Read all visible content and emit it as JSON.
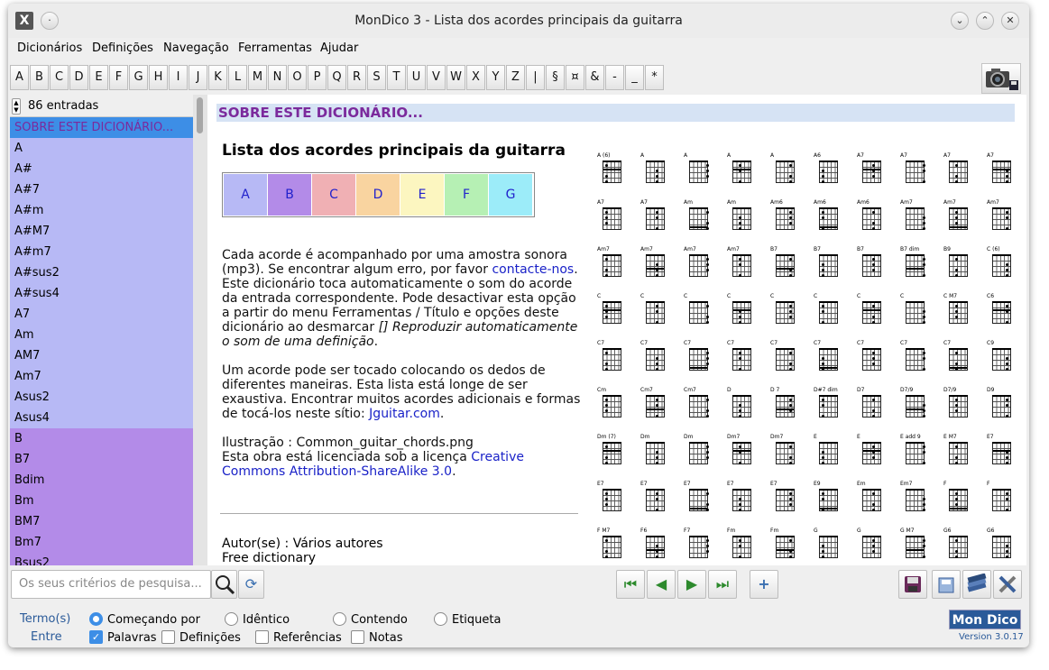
{
  "window": {
    "title": "MonDico 3 - Lista dos acordes principais da guitarra"
  },
  "menubar": [
    "Dicionários",
    "Definições",
    "Navegação",
    "Ferramentas",
    "Ajudar"
  ],
  "alphabet": [
    "A",
    "B",
    "C",
    "D",
    "E",
    "F",
    "G",
    "H",
    "I",
    "J",
    "K",
    "L",
    "M",
    "N",
    "O",
    "P",
    "Q",
    "R",
    "S",
    "T",
    "U",
    "V",
    "W",
    "X",
    "Y",
    "Z",
    "|",
    "§",
    "¤",
    "&",
    "-",
    "_",
    "*"
  ],
  "sidebar": {
    "count_label": "86 entradas",
    "entries": [
      {
        "label": "SOBRE ESTE DICIONÁRIO...",
        "group": "sel"
      },
      {
        "label": "A",
        "group": "a"
      },
      {
        "label": "A#",
        "group": "a"
      },
      {
        "label": "A#7",
        "group": "a"
      },
      {
        "label": "A#m",
        "group": "a"
      },
      {
        "label": "A#M7",
        "group": "a"
      },
      {
        "label": "A#m7",
        "group": "a"
      },
      {
        "label": "A#sus2",
        "group": "a"
      },
      {
        "label": "A#sus4",
        "group": "a"
      },
      {
        "label": "A7",
        "group": "a"
      },
      {
        "label": "Am",
        "group": "a"
      },
      {
        "label": "AM7",
        "group": "a"
      },
      {
        "label": "Am7",
        "group": "a"
      },
      {
        "label": "Asus2",
        "group": "a"
      },
      {
        "label": "Asus4",
        "group": "a"
      },
      {
        "label": "B",
        "group": "b"
      },
      {
        "label": "B7",
        "group": "b"
      },
      {
        "label": "Bdim",
        "group": "b"
      },
      {
        "label": "Bm",
        "group": "b"
      },
      {
        "label": "BM7",
        "group": "b"
      },
      {
        "label": "Bm7",
        "group": "b"
      },
      {
        "label": "Bsus2",
        "group": "b"
      }
    ]
  },
  "content": {
    "banner": "SOBRE ESTE DICIONÁRIO...",
    "heading": "Lista dos acordes principais da guitarra",
    "letters": [
      {
        "label": "A",
        "color": "#b7b9f5"
      },
      {
        "label": "B",
        "color": "#b38be8"
      },
      {
        "label": "C",
        "color": "#f0b0b4"
      },
      {
        "label": "D",
        "color": "#f9d4a0"
      },
      {
        "label": "E",
        "color": "#fcf6c0"
      },
      {
        "label": "F",
        "color": "#b6f0b4"
      },
      {
        "label": "G",
        "color": "#9cecf9"
      }
    ],
    "p1_text": "Cada acorde é acompanhado por uma amostra sonora (mp3). Se encontrar algum erro, por favor ",
    "p1_link": "contacte-nos",
    "p1_end": ".",
    "p2_text": "Este dicionário toca automaticamente o som do acorde da entrada correspondente. Pode desactivar esta opção a partir do menu Ferramentas / Título e opções deste dicionário ao desmarcar ",
    "p2_italic": "[] Reproduzir automaticamente o som de uma definição",
    "p2_end": ".",
    "p3_text": "Um acorde pode ser tocado colocando os dedos de diferentes maneiras. Esta lista está longe de ser exaustiva. Encontrar muitos acordes adicionais e formas de tocá-los neste sítio: ",
    "p3_link": "Jguitar.com",
    "p3_end": ".",
    "p4_line1": "Ilustração : Common_guitar_chords.png",
    "p4_text": "Esta obra está licenciada sob a licença ",
    "p4_link": "Creative Commons Attribution-ShareAlike 3.0",
    "p4_end": ".",
    "author": "Autor(se) : Vários autores",
    "license": "Free dictionary"
  },
  "chord_image": {
    "rows": [
      [
        "A (6)",
        "A",
        "A",
        "A",
        "A",
        "A6",
        "A7",
        "A7",
        "A7",
        "A7"
      ],
      [
        "A7",
        "A7",
        "Am",
        "Am",
        "Am6",
        "Am6",
        "Am6",
        "Am7",
        "Am7",
        "Am7"
      ],
      [
        "Am7",
        "Am7",
        "Am7",
        "Am7",
        "B7",
        "B7",
        "B7",
        "B7 dim",
        "B9",
        "C (6)"
      ],
      [
        "C",
        "C",
        "C",
        "C",
        "C",
        "C",
        "C",
        "C",
        "C M7",
        "C6"
      ],
      [
        "C7",
        "C7",
        "C7",
        "C7",
        "C7",
        "C7",
        "C7",
        "C7",
        "C7",
        "C9"
      ],
      [
        "Cm",
        "Cm7",
        "Cm7",
        "D",
        "D 7",
        "D#7 dim",
        "D7",
        "D7/9",
        "D7/9",
        "D9"
      ],
      [
        "Dm (7)",
        "Dm",
        "Dm",
        "Dm7",
        "Dm7",
        "E",
        "E",
        "E add 9",
        "E M7",
        "E7"
      ],
      [
        "E7",
        "E7",
        "E7",
        "E7",
        "E7",
        "E9",
        "Em",
        "Em7",
        "F",
        "F"
      ],
      [
        "F M7",
        "F6",
        "F7",
        "Fm",
        "Fm",
        "G",
        "G",
        "G M7",
        "G6",
        "G6"
      ]
    ]
  },
  "search": {
    "placeholder": "Os seus critérios de pesquisa..."
  },
  "options": {
    "term_label": "Termo(s)",
    "entry_label": "Entre",
    "radios": [
      "Começando por",
      "Idêntico",
      "Contendo",
      "Etiqueta"
    ],
    "radio_selected": "Começando por",
    "checks": [
      "Palavras",
      "Definições",
      "Referências",
      "Notas"
    ],
    "checks_selected": [
      "Palavras"
    ]
  },
  "brand": {
    "logo": "Mon Dico",
    "version": "Version 3.0.17"
  }
}
